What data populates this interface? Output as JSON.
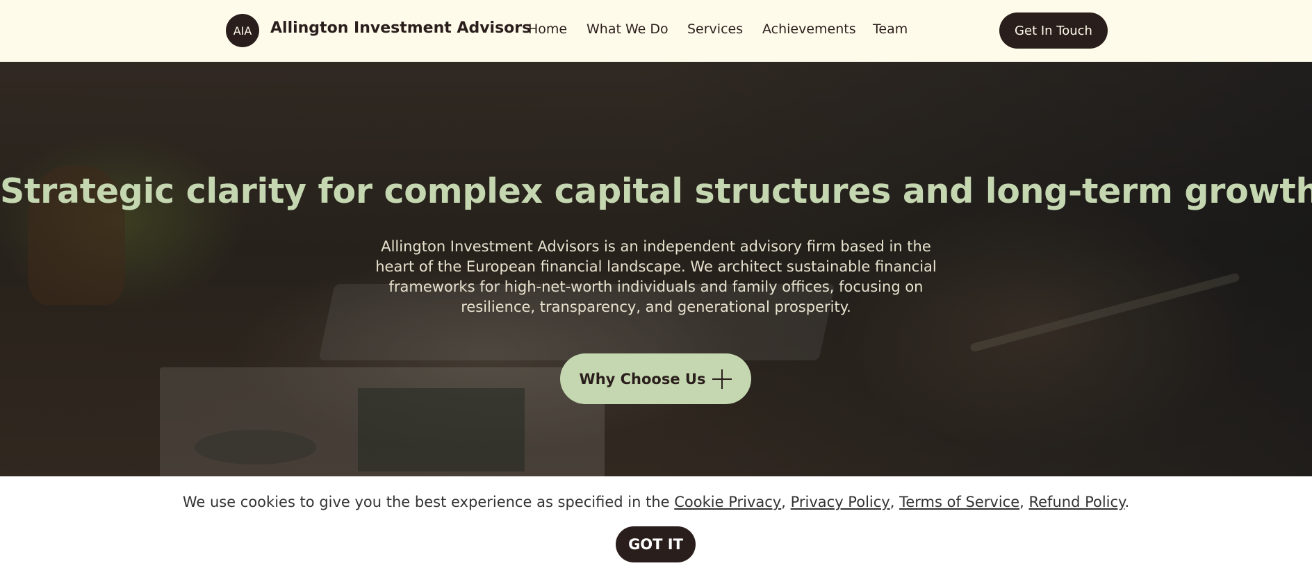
{
  "header": {
    "logo_text": "AIA",
    "brand_name": "Allington Investment Advisors",
    "nav": [
      "Home",
      "What We Do",
      "Services",
      "Achievements",
      "Team"
    ],
    "cta_label": "Get In Touch"
  },
  "hero": {
    "title": "Strategic clarity for complex capital structures and long-term growth",
    "description": "Allington Investment Advisors is an independent advisory firm based in the heart of the European financial landscape. We architect sustainable financial frameworks for high-net-worth individuals and family offices, focusing on resilience, transparency, and generational prosperity.",
    "button_label": "Why Choose Us",
    "button_icon": "plus-icon"
  },
  "cookie_banner": {
    "text_before": "We use cookies to give you the best experience as specified in the ",
    "links": [
      "Cookie Privacy",
      "Privacy Policy",
      "Terms of Service",
      "Refund Policy"
    ],
    "separator": ", ",
    "text_after": ".",
    "accept_label": "GOT IT"
  },
  "colors": {
    "background": "#fffbea",
    "dark": "#2a1e1c",
    "accent_green": "#c5d7b0"
  }
}
